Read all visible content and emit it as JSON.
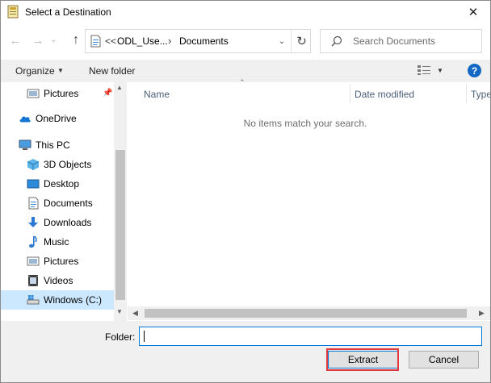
{
  "window": {
    "title": "Select a Destination",
    "close_glyph": "✕"
  },
  "address": {
    "overflow": "<<",
    "segments": [
      "ODL_Use...",
      "Documents"
    ]
  },
  "search": {
    "placeholder": "Search Documents"
  },
  "toolbar": {
    "organize": "Organize",
    "new_folder": "New folder",
    "help": "?"
  },
  "navpane": {
    "items": [
      {
        "label": "Pictures",
        "icon": "pictures-icon"
      },
      {
        "label": "OneDrive",
        "icon": "onedrive-icon"
      },
      {
        "label": "This PC",
        "icon": "this-pc-icon"
      },
      {
        "label": "3D Objects",
        "icon": "3d-objects-icon"
      },
      {
        "label": "Desktop",
        "icon": "desktop-icon"
      },
      {
        "label": "Documents",
        "icon": "documents-icon"
      },
      {
        "label": "Downloads",
        "icon": "downloads-icon"
      },
      {
        "label": "Music",
        "icon": "music-icon"
      },
      {
        "label": "Pictures",
        "icon": "pictures-icon"
      },
      {
        "label": "Videos",
        "icon": "videos-icon"
      },
      {
        "label": "Windows (C:)",
        "icon": "drive-icon"
      }
    ],
    "selected": "Windows (C:)"
  },
  "filelist": {
    "columns": [
      "Name",
      "Date modified",
      "Type"
    ],
    "empty_message": "No items match your search."
  },
  "bottom": {
    "folder_label": "Folder:",
    "folder_value": "",
    "extract_label": "Extract",
    "cancel_label": "Cancel"
  },
  "colors": {
    "accent": "#0078d7",
    "highlight": "#e0393e",
    "selected_bg": "#cce8ff"
  }
}
